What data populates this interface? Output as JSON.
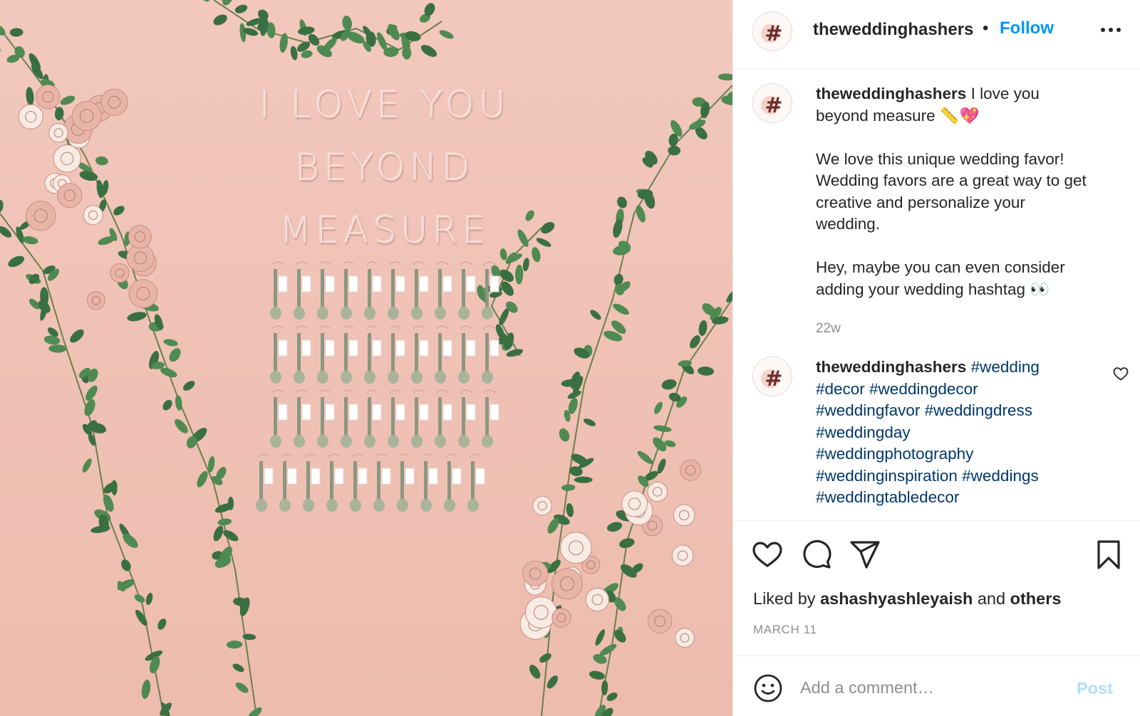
{
  "photo": {
    "wall_text": [
      "I LOVE YOU",
      "BEYOND",
      "MEASURE"
    ],
    "colors": {
      "wall": "#efc1b4",
      "leaf": "#4f8a52",
      "leaf_dark": "#3a6f42",
      "rose": "#e8b4a8",
      "white_rose": "#f7ebe3",
      "spoon": "#a9b39a",
      "tag": "#ffffff"
    }
  },
  "header": {
    "username": "theweddinghashers",
    "separator": "•",
    "follow_label": "Follow",
    "more_icon": "more-horizontal-icon",
    "avatar_mark": "#"
  },
  "caption": {
    "username": "theweddinghashers",
    "line1": "I love you beyond measure 📏💖",
    "para2": "We love this unique wedding favor! Wedding favors are a great way to get creative and personalize your wedding.",
    "para3": "Hey, maybe you can even consider adding your wedding hashtag 👀",
    "age": "22w"
  },
  "hashtag_comment": {
    "username": "theweddinghashers",
    "hashtags": "#wedding #decor #weddingdecor #weddingfavor #weddingdress #weddingday #weddingphotography #weddinginspiration #weddings #weddingtabledecor",
    "heart_icon": "heart-outline-icon"
  },
  "actions": {
    "icons": [
      "heart-icon",
      "comment-icon",
      "share-icon",
      "bookmark-icon"
    ],
    "liked_prefix": "Liked by",
    "liked_user": "ashashyashleyaish",
    "liked_and": "and",
    "liked_others": "others",
    "date": "MARCH 11"
  },
  "add_comment": {
    "placeholder": "Add a comment…",
    "post_label": "Post",
    "emoji_icon": "smiley-icon"
  },
  "colors": {
    "link_blue": "#0095f6",
    "hashtag": "#00376b",
    "post_disabled": "#b2dffc",
    "muted": "#8e8e8e",
    "text": "#262626"
  }
}
